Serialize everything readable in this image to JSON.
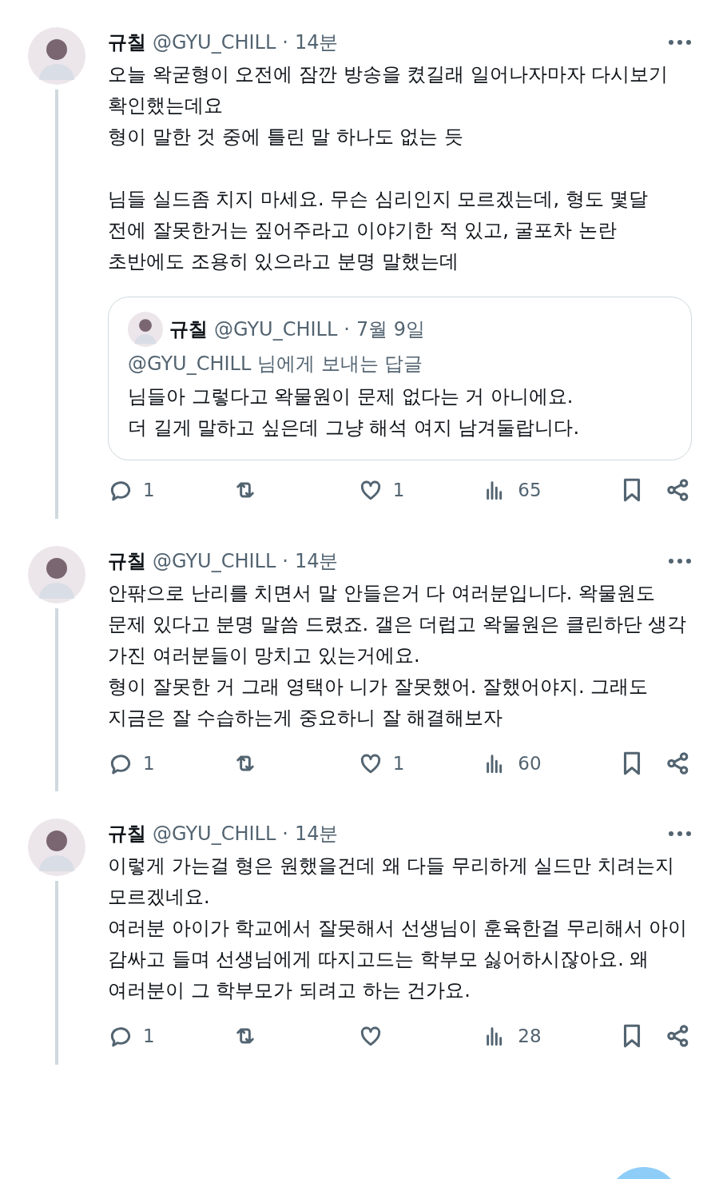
{
  "tweets": [
    {
      "author": {
        "name": "규칠",
        "handle": "@GYU_CHILL",
        "separator": "·",
        "time": "14분"
      },
      "body": "오늘 왁굳형이 오전에 잠깐 방송을 켰길래 일어나자마자 다시보기 확인했는데요\n형이 말한 것 중에 틀린 말 하나도 없는 듯\n\n님들 실드좀 치지 마세요. 무슨 심리인지 모르겠는데, 형도 몇달 전에 잘못한거는 짚어주라고 이야기한 적 있고, 굴포차 논란 초반에도 조용히 있으라고 분명 말했는데",
      "quote": {
        "author": {
          "name": "규칠",
          "handle": "@GYU_CHILL",
          "separator": "·",
          "time": "7월 9일"
        },
        "reply_to": "@GYU_CHILL 님에게 보내는 답글",
        "body": "님들아 그렇다고 왁물원이 문제 없다는 거 아니에요.\n더 길게 말하고 싶은데 그냥 해석 여지 남겨둘랍니다."
      },
      "actions": {
        "replies": "1",
        "likes": "1",
        "views": "65"
      }
    },
    {
      "author": {
        "name": "규칠",
        "handle": "@GYU_CHILL",
        "separator": "·",
        "time": "14분"
      },
      "body": "안팎으로 난리를 치면서 말 안들은거 다 여러분입니다. 왁물원도 문제 있다고 분명 말씀 드렸죠. 갤은 더럽고 왁물원은 클린하단 생각 가진 여러분들이 망치고 있는거에요.\n형이 잘못한 거 그래 영택아 니가 잘못했어. 잘했어야지. 그래도 지금은 잘 수습하는게 중요하니 잘 해결해보자",
      "actions": {
        "replies": "1",
        "likes": "1",
        "views": "60"
      }
    },
    {
      "author": {
        "name": "규칠",
        "handle": "@GYU_CHILL",
        "separator": "·",
        "time": "14분"
      },
      "body": "이렇게 가는걸 형은 원했을건데 왜 다들 무리하게 실드만 치려는지 모르겠네요.\n여러분 아이가 학교에서 잘못해서 선생님이 훈육한걸 무리해서 아이 감싸고 들며 선생님에게 따지고드는 학부모 싫어하시잖아요. 왜 여러분이 그 학부모가 되려고 하는 건가요.",
      "actions": {
        "replies": "1",
        "views": "28"
      }
    }
  ]
}
